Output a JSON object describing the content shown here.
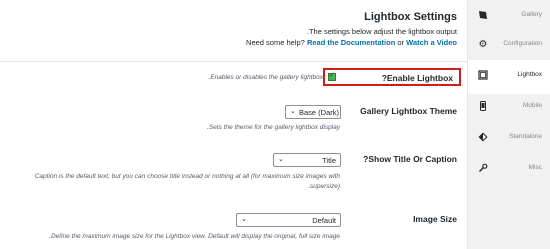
{
  "header": {
    "title": "Lightbox Settings",
    "description": ".The settings below adjust the lightbox output",
    "help_prefix": "Need some help?",
    "help_link_docs": "Read the Documentation",
    "help_or": "or",
    "help_link_video": "Watch a Video"
  },
  "settings": {
    "enable_lightbox": {
      "label": "?Enable Lightbox",
      "description": ".Enables or disables the gallery lightbox",
      "checked": true
    },
    "theme": {
      "label": "Gallery Lightbox Theme",
      "value": "Base (Dark)",
      "description": ".Sets the theme for the gallery lightbox display"
    },
    "show_title": {
      "label": "?Show Title Or Caption",
      "value": "Title",
      "description_line1": "Caption is the default text, but you can choose title instead or nothing at all (for maximum size images with",
      "description_line2": ".supersize)"
    },
    "image_size": {
      "label": "Image Size",
      "value": "Default",
      "description": ".Define the maximum image size for the Lightbox view. Default will display the original, full size image"
    }
  },
  "sidebar": {
    "items": [
      {
        "label": "Gallery",
        "icon": "gallery-icon",
        "active": false
      },
      {
        "label": "Configuration",
        "icon": "gear-icon",
        "active": false
      },
      {
        "label": "Lightbox",
        "icon": "lightbox-icon",
        "active": true
      },
      {
        "label": "Mobile",
        "icon": "mobile-icon",
        "active": false
      },
      {
        "label": "Standalone",
        "icon": "standalone-icon",
        "active": false
      },
      {
        "label": "Misc",
        "icon": "wrench-icon",
        "active": false
      }
    ]
  },
  "colors": {
    "link": "#0073aa",
    "highlight_border": "#d11c1c",
    "checkbox": "#46b450",
    "sidebar_bg": "#f1f1f1"
  }
}
